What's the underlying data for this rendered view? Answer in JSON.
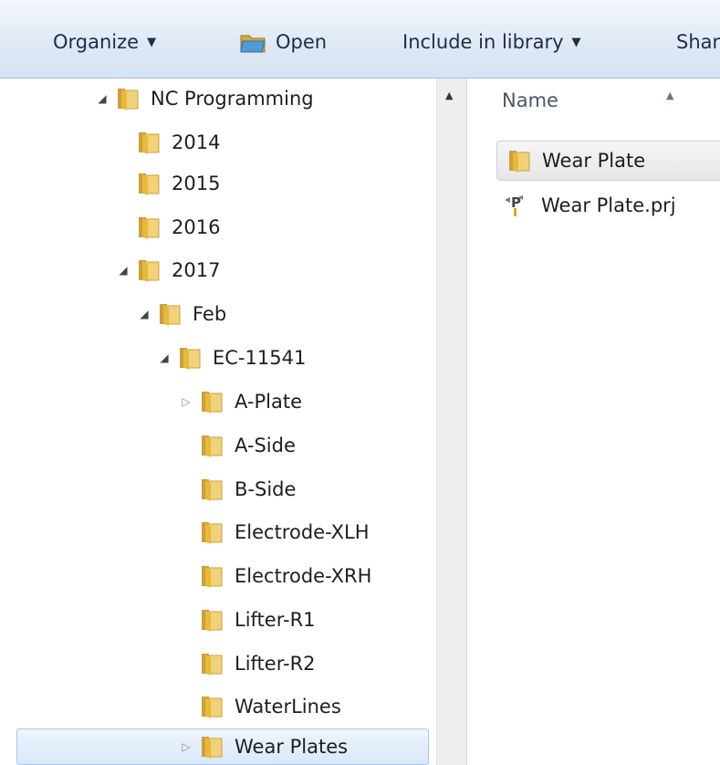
{
  "toolbar": {
    "organize_label": "Organize",
    "open_label": "Open",
    "include_label": "Include in library",
    "share_label": "Shar"
  },
  "nav_tree": {
    "items": [
      {
        "label": "NC Programming",
        "expander": "expanded"
      },
      {
        "label": "2014",
        "expander": "none"
      },
      {
        "label": "2015",
        "expander": "none"
      },
      {
        "label": "2016",
        "expander": "none"
      },
      {
        "label": "2017",
        "expander": "expanded"
      },
      {
        "label": "Feb",
        "expander": "expanded"
      },
      {
        "label": "EC-11541",
        "expander": "expanded"
      },
      {
        "label": "A-Plate",
        "expander": "collapsed"
      },
      {
        "label": "A-Side",
        "expander": "none"
      },
      {
        "label": "B-Side",
        "expander": "none"
      },
      {
        "label": "Electrode-XLH",
        "expander": "none"
      },
      {
        "label": "Electrode-XRH",
        "expander": "none"
      },
      {
        "label": "Lifter-R1",
        "expander": "none"
      },
      {
        "label": "Lifter-R2",
        "expander": "none"
      },
      {
        "label": "WaterLines",
        "expander": "none"
      },
      {
        "label": "Wear Plates",
        "expander": "collapsed",
        "selected": true
      }
    ]
  },
  "content": {
    "column_name": "Name",
    "files": [
      {
        "label": "Wear Plate",
        "icon": "folder-icon"
      },
      {
        "label": "Wear Plate.prj",
        "icon": "project-file-icon"
      }
    ]
  },
  "icons": {
    "folder_color": "#e8c25a",
    "expander_expanded": "◢",
    "expander_collapsed": "▷",
    "dropdown": "▼"
  }
}
